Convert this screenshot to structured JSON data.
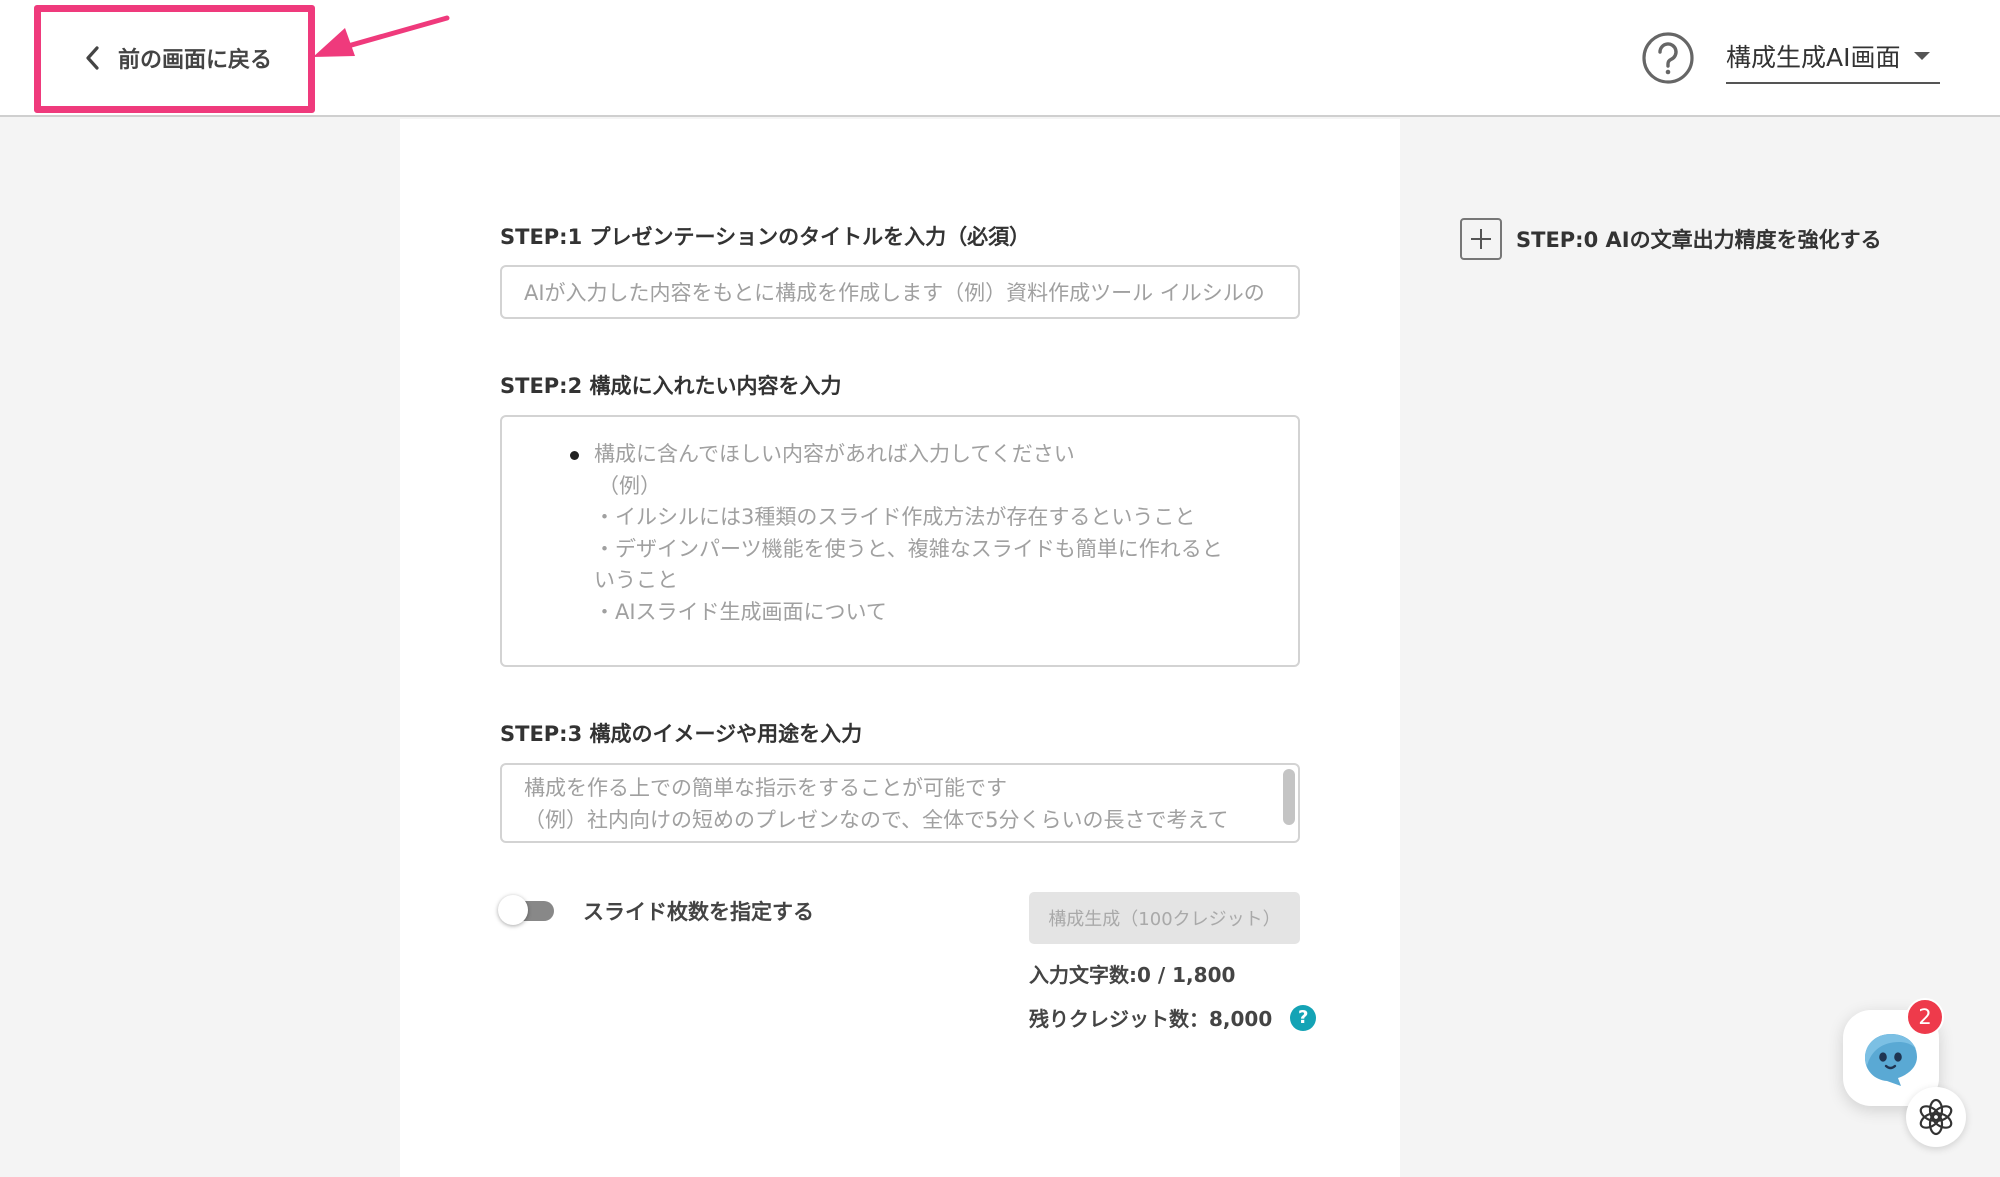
{
  "header": {
    "back_label": "前の画面に戻る",
    "screen_select_value": "構成生成AI画面"
  },
  "form": {
    "step1_label": "STEP:1 プレゼンテーションのタイトルを入力（必須）",
    "step1_placeholder": "AIが入力した内容をもとに構成を作成します（例）資料作成ツール イルシルの",
    "step2_label": "STEP:2 構成に入れたい内容を入力",
    "step2_lines": [
      "構成に含んでほしい内容があれば入力してください",
      "（例）",
      "・イルシルには3種類のスライド作成方法が存在するということ",
      "・デザインパーツ機能を使うと、複雑なスライドも簡単に作れると",
      "いうこと",
      "・AIスライド生成画面について"
    ],
    "step3_label": "STEP:3 構成のイメージや用途を入力",
    "step3_lines": [
      "構成を作る上での簡単な指示をすることが可能です",
      "（例）社内向けの短めのプレゼンなので、全体で5分くらいの長さで考えて"
    ],
    "toggle_label": "スライド枚数を指定する",
    "toggle_on": false,
    "generate_label": "構成生成（100クレジット）",
    "char_count": "入力文字数:0 / 1,800",
    "credits": "残りクレジット数：8,000",
    "credit_help_glyph": "?"
  },
  "sidebar_right": {
    "step0_label": "STEP:0 AIの文章出力精度を強化する"
  },
  "chat": {
    "badge_count": "2"
  },
  "colors": {
    "highlight": "#ef3a7c",
    "help_accent": "#14a3b5",
    "badge": "#ee3a4b"
  }
}
